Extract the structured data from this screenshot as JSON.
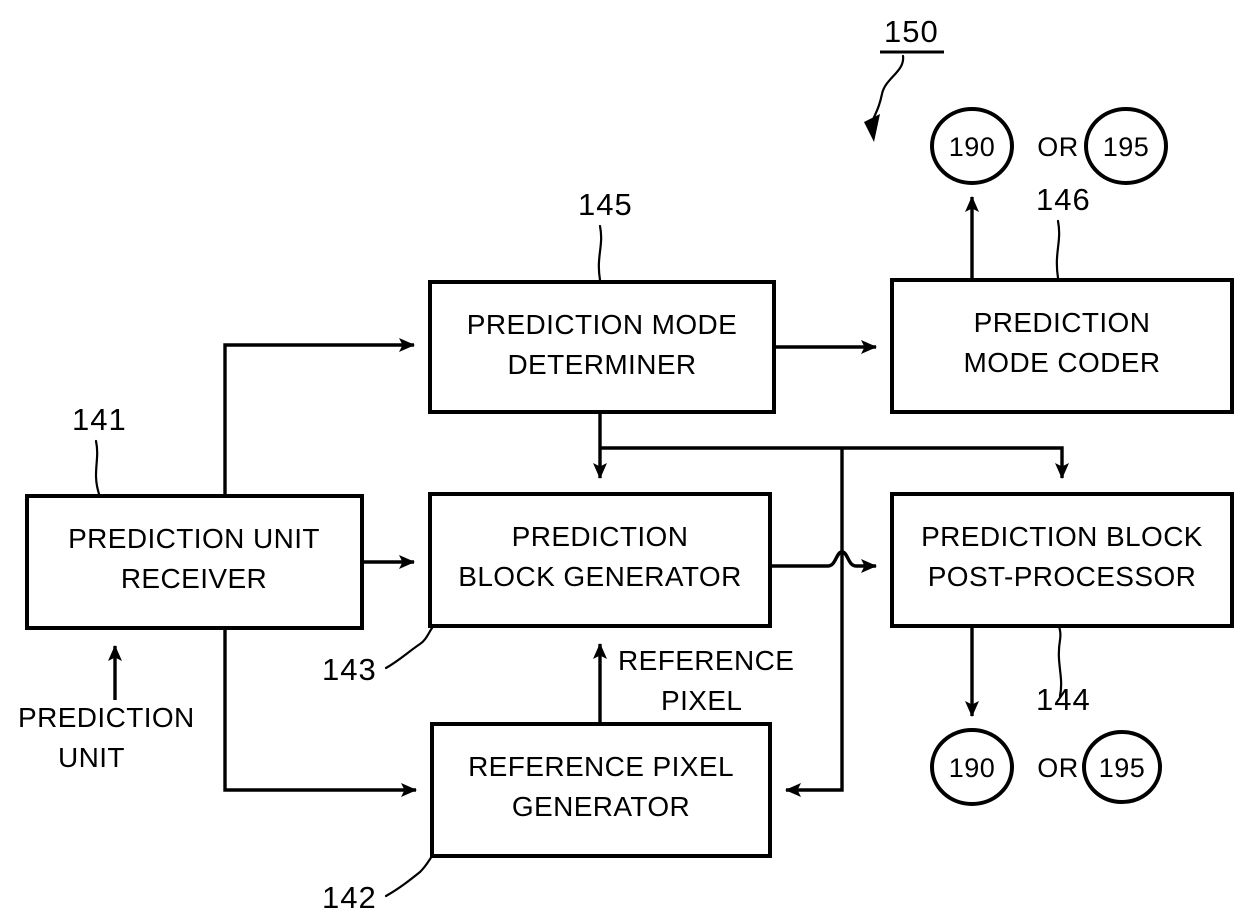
{
  "figure": {
    "reference_number": "150",
    "type": "patent-block-diagram"
  },
  "blocks": [
    {
      "id": "prediction-unit-receiver",
      "ref": "141",
      "line1": "PREDICTION UNIT",
      "line2": "RECEIVER"
    },
    {
      "id": "prediction-mode-determiner",
      "ref": "145",
      "line1": "PREDICTION MODE",
      "line2": "DETERMINER"
    },
    {
      "id": "prediction-mode-coder",
      "ref": "146",
      "line1": "PREDICTION",
      "line2": "MODE CODER"
    },
    {
      "id": "prediction-block-generator",
      "ref": "143",
      "line1": "PREDICTION",
      "line2": "BLOCK GENERATOR"
    },
    {
      "id": "prediction-block-post-processor",
      "ref": "144",
      "line1": "PREDICTION BLOCK",
      "line2": "POST-PROCESSOR"
    },
    {
      "id": "reference-pixel-generator",
      "ref": "142",
      "line1": "REFERENCE PIXEL",
      "line2": "GENERATOR"
    }
  ],
  "labels": {
    "figure_ref": "150",
    "receiver_ref": "141",
    "determiner_ref": "145",
    "coder_ref": "146",
    "generator_ref": "143",
    "post_processor_ref": "144",
    "ref_pixel_gen_ref": "142",
    "input_line1": "PREDICTION",
    "input_line2": "UNIT",
    "reference_pixel_line1": "REFERENCE",
    "reference_pixel_line2": "PIXEL",
    "or_top": "OR",
    "or_bottom": "OR"
  },
  "circles": {
    "top_left_num": "190",
    "top_right_num": "195",
    "bottom_left_num": "190",
    "bottom_right_num": "195"
  },
  "colors": {
    "stroke": "#000000",
    "background": "#ffffff"
  }
}
